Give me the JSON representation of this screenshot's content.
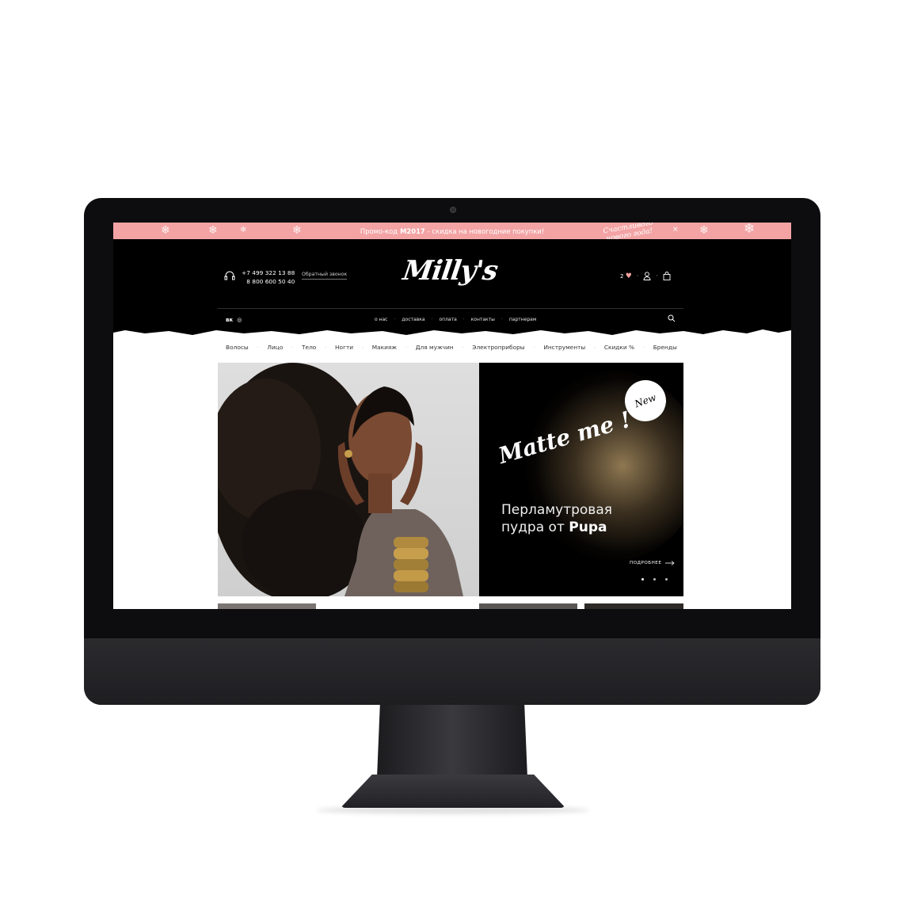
{
  "promo": {
    "text_before": "Промо-код",
    "code": "M2017",
    "text_after": "- скидка на новогодние покупки!",
    "script_line1": "Счастливого",
    "script_line2": "нового года!",
    "close_label": "×"
  },
  "header": {
    "phone1": "+7 499 322 13 88",
    "phone2": "8 800 600 50 40",
    "callback_label": "Обратный звонок",
    "logo": "Milly's",
    "favorites_count": "2",
    "social": [
      "вк",
      "◎"
    ],
    "topnav": [
      "о нас",
      "доставка",
      "оплата",
      "контакты",
      "партнерам"
    ]
  },
  "categories": [
    "Волосы",
    "Лицо",
    "Тело",
    "Ногти",
    "Макияж",
    "Для мужчин",
    "Электроприборы",
    "Инструменты",
    "Скидки %",
    "Бренды"
  ],
  "hero": {
    "badge": "New",
    "script": "Matte me !",
    "title_line1": "Перламутровая",
    "title_line2_prefix": "пудра от",
    "brand": "Pupa",
    "more_label": "ПОДРОБНЕЕ"
  },
  "colors": {
    "promo_bg": "#f3a3a4",
    "header_bg": "#000000",
    "accent": "#f3a3a4"
  }
}
